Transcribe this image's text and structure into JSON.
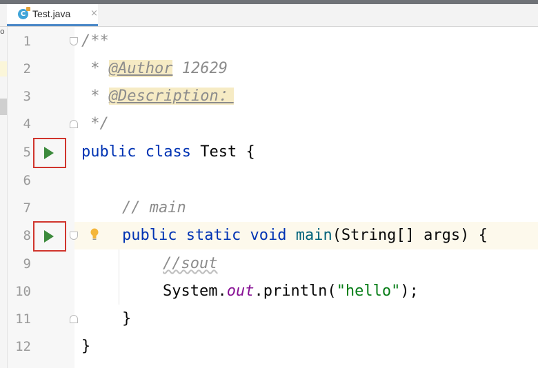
{
  "tab": {
    "title": "Test.java",
    "close": "×",
    "icon": "java-class-icon",
    "icon_letter": "C"
  },
  "left_panel": {
    "clipped_text": "o"
  },
  "lines": [
    {
      "n": "1"
    },
    {
      "n": "2"
    },
    {
      "n": "3"
    },
    {
      "n": "4"
    },
    {
      "n": "5"
    },
    {
      "n": "6"
    },
    {
      "n": "7"
    },
    {
      "n": "8"
    },
    {
      "n": "9"
    },
    {
      "n": "10"
    },
    {
      "n": "11"
    },
    {
      "n": "12"
    }
  ],
  "code": {
    "l1": {
      "comment": "/**"
    },
    "l2": {
      "star": " * ",
      "ann": "@Author",
      "rest": " 12629"
    },
    "l3": {
      "star": " * ",
      "ann": "@Description："
    },
    "l4": {
      "comment": " */"
    },
    "l5": {
      "kw1": "public",
      "kw2": "class",
      "name": "Test",
      "brace": " {"
    },
    "l7": {
      "comment": "// main"
    },
    "l8": {
      "kw1": "public",
      "kw2": "static",
      "kw3": "void",
      "fn": "main",
      "params": "(String[] args) {"
    },
    "l9": {
      "comment": "//sout"
    },
    "l10": {
      "obj": "System.",
      "field": "out",
      "call": ".println(",
      "str": "\"hello\"",
      "end": ");"
    },
    "l11": {
      "brace": "}"
    },
    "l12": {
      "brace": "}"
    }
  },
  "colors": {
    "keyword": "#0033b3",
    "comment": "#8c8c8c",
    "string": "#067d17",
    "field": "#871094",
    "run": "#3c8a3c",
    "highlight_box": "#d0342c"
  }
}
